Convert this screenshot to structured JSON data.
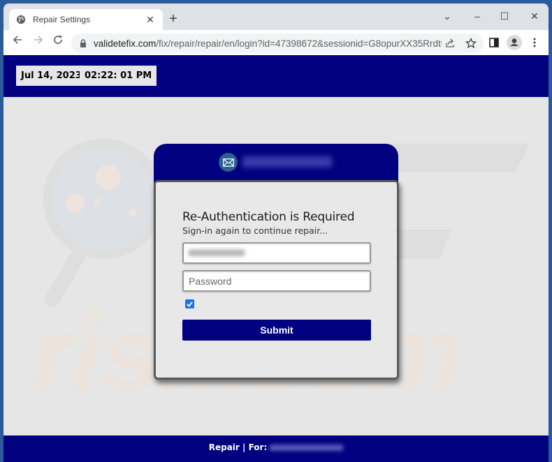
{
  "browser": {
    "tab": {
      "title": "Repair Settings",
      "icon": "globe-icon"
    },
    "new_tab_label": "+",
    "window_controls": {
      "tab_search": "⌄",
      "minimize": "–",
      "maximize": "☐",
      "close": "✕"
    },
    "address_bar": {
      "host": "validetefix.com",
      "path": "/fix/repair/repair/en/login?id=47398672&sessionid=G8opurXX35RrdttB..."
    }
  },
  "header": {
    "date": "Jul 14, 2023",
    "time": "02:22: 01 PM",
    "bg_color": "#000080"
  },
  "card": {
    "brand_icon": "envelope-icon",
    "brand_text_blurred": true,
    "title": "Re-Authentication is Required",
    "subtitle": "Sign-in again to continue repair...",
    "email_value_blurred": true,
    "password_placeholder": "Password",
    "remember_checked": true,
    "submit_label": "Submit"
  },
  "footer": {
    "label": "Repair | For:",
    "email_blurred": true
  },
  "watermark": {
    "text": "risk.com"
  },
  "colors": {
    "accent": "#000080",
    "page_bg": "#e6e6e6",
    "checkbox": "#1a73e8"
  }
}
